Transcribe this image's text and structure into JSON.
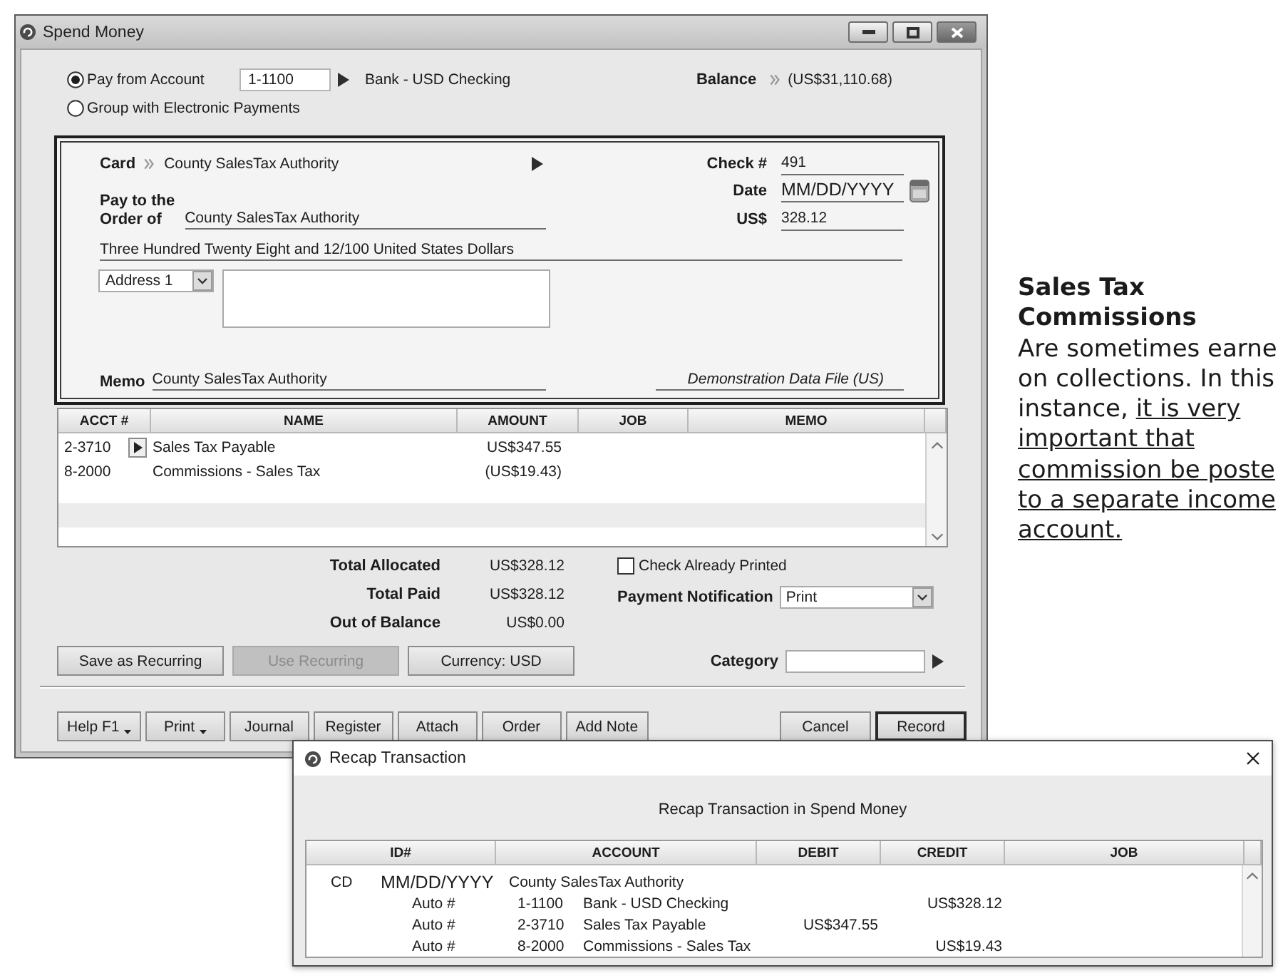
{
  "spend_money": {
    "title": "Spend Money",
    "pay_options": [
      {
        "label": "Pay from Account",
        "selected": true
      },
      {
        "label": "Group with Electronic Payments",
        "selected": false
      }
    ],
    "account": {
      "number": "1-1100",
      "name": "Bank - USD Checking"
    },
    "balance": {
      "label": "Balance",
      "value": "(US$31,110.68)"
    },
    "check": {
      "card_label": "Card",
      "card": "County SalesTax Authority",
      "check_number_label": "Check #",
      "check_number": "491",
      "date_label": "Date",
      "date": "MM/DD/YYYY",
      "amount_label": "US$",
      "amount": "328.12",
      "pay_to_label": "Pay to the\nOrder of",
      "payee": "County SalesTax Authority",
      "amount_in_words": "Three Hundred Twenty Eight and 12/100 United States Dollars",
      "address": "Address 1",
      "memo_label": "Memo",
      "memo": "County SalesTax Authority",
      "data_file": "Demonstration Data File (US)"
    },
    "allocation_table": {
      "columns": [
        "ACCT #",
        "NAME",
        "AMOUNT",
        "JOB",
        "MEMO"
      ],
      "rows": [
        {
          "account": "2-3710",
          "name": "Sales Tax Payable",
          "amount": "US$347.55",
          "selected": true
        },
        {
          "account": "8-2000",
          "name": "Commissions - Sales Tax",
          "amount": "(US$19.43)",
          "selected": false
        }
      ]
    },
    "totals": [
      {
        "label": "Total Allocated",
        "value": "US$328.12"
      },
      {
        "label": "Total Paid",
        "value": "US$328.12"
      },
      {
        "label": "Out of Balance",
        "value": "US$0.00"
      }
    ],
    "check_already_printed": {
      "label": "Check Already Printed",
      "checked": false
    },
    "payment_notification": {
      "label": "Payment Notification",
      "value": "Print"
    },
    "action_buttons": [
      {
        "label": "Save as Recurring",
        "disabled": false
      },
      {
        "label": "Use Recurring",
        "disabled": true
      },
      {
        "label": "Currency: USD",
        "disabled": false
      }
    ],
    "category": {
      "label": "Category"
    },
    "left_buttons": [
      {
        "label": "Help F1",
        "kind": "menu"
      },
      {
        "label": "Print",
        "kind": "menu"
      },
      {
        "label": "Journal",
        "kind": "plain"
      },
      {
        "label": "Register",
        "kind": "plain"
      },
      {
        "label": "Attach",
        "kind": "plain"
      },
      {
        "label": "Order",
        "kind": "plain"
      },
      {
        "label": "Add Note",
        "kind": "plain"
      }
    ],
    "right_buttons": [
      {
        "label": "Cancel",
        "kind": "plain"
      },
      {
        "label": "Record",
        "kind": "default"
      }
    ]
  },
  "note": {
    "title": "Sales Tax Commissions",
    "text": "Are sometimes earne\non collections. In this\ninstance,",
    "underlined": "it is very\nimportant that\ncommission be poste\nto a separate income\naccount."
  },
  "recap": {
    "title": "Recap Transaction",
    "heading": "Recap Transaction in Spend Money",
    "columns": [
      "ID#",
      "ACCOUNT",
      "DEBIT",
      "CREDIT",
      "JOB"
    ],
    "rows": [
      {
        "kind": "entry",
        "type": "CD",
        "date": "MM/DD/YYYY",
        "name": "County SalesTax Authority"
      },
      {
        "kind": "line",
        "id": "Auto #",
        "account": "1-1100",
        "name": "Bank - USD Checking",
        "credit": "US$328.12"
      },
      {
        "kind": "line",
        "id": "Auto #",
        "account": "2-3710",
        "name": "Sales Tax Payable",
        "debit": "US$347.55"
      },
      {
        "kind": "line",
        "id": "Auto #",
        "account": "8-2000",
        "name": "Commissions - Sales Tax",
        "credit": "US$19.43"
      }
    ]
  }
}
